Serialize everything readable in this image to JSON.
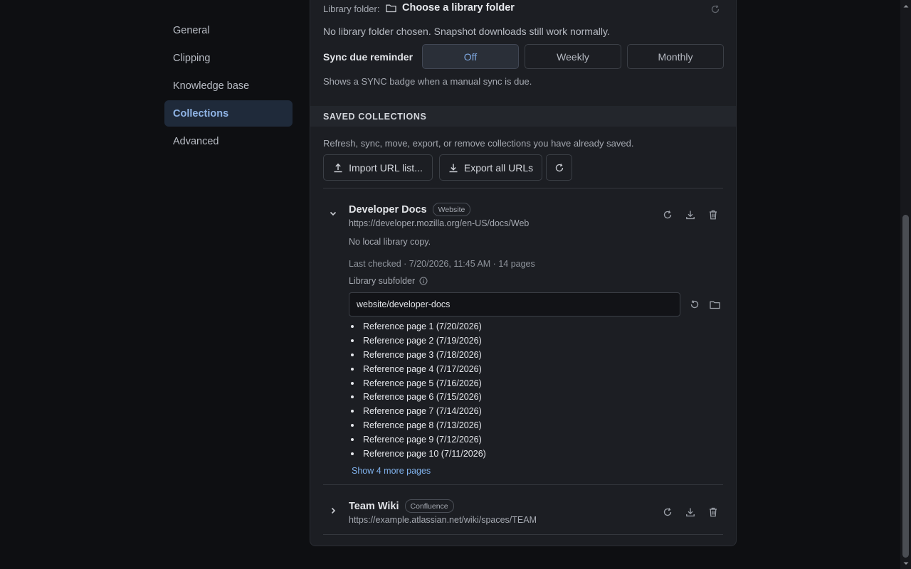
{
  "sidebar": {
    "items": [
      {
        "label": "General"
      },
      {
        "label": "Clipping"
      },
      {
        "label": "Knowledge base"
      },
      {
        "label": "Collections"
      },
      {
        "label": "Advanced"
      }
    ]
  },
  "library": {
    "label": "Library folder:",
    "choose_label": "Choose a library folder",
    "status": "No library folder chosen. Snapshot downloads still work normally."
  },
  "sync": {
    "label": "Sync due reminder",
    "options": [
      "Off",
      "Weekly",
      "Monthly"
    ],
    "selected": "Off",
    "hint": "Shows a SYNC badge when a manual sync is due."
  },
  "saved": {
    "heading": "SAVED COLLECTIONS",
    "description": "Refresh, sync, move, export, or remove collections you have already saved.",
    "import_label": "Import URL list...",
    "export_label": "Export all URLs"
  },
  "collections": [
    {
      "name": "Developer Docs",
      "badge": "Website",
      "url": "https://developer.mozilla.org/en-US/docs/Web",
      "expanded": true,
      "local_status": "No local library copy.",
      "last_checked": "Last checked · 7/20/2026, 11:45 AM · 14 pages",
      "subfolder_label": "Library subfolder",
      "subfolder_value": "website/developer-docs",
      "pages": [
        "Reference page 1 (7/20/2026)",
        "Reference page 2 (7/19/2026)",
        "Reference page 3 (7/18/2026)",
        "Reference page 4 (7/17/2026)",
        "Reference page 5 (7/16/2026)",
        "Reference page 6 (7/15/2026)",
        "Reference page 7 (7/14/2026)",
        "Reference page 8 (7/13/2026)",
        "Reference page 9 (7/12/2026)",
        "Reference page 10 (7/11/2026)"
      ],
      "show_more": "Show 4 more pages"
    },
    {
      "name": "Team Wiki",
      "badge": "Confluence",
      "url": "https://example.atlassian.net/wiki/spaces/TEAM",
      "expanded": false
    }
  ],
  "icons": {
    "folder": "folder-icon",
    "refresh": "refresh-icon",
    "upload": "upload-icon",
    "download": "download-icon",
    "trash": "trash-icon",
    "info": "info-icon",
    "reset": "reset-icon",
    "chevron_down": "chevron-down-icon",
    "chevron_right": "chevron-right-icon"
  },
  "colors": {
    "background": "#0e0f12",
    "panel": "#1c1e23",
    "accent": "#7fa8e0",
    "link": "#7fb0ea",
    "sidebar_active_bg": "#1f2a3a"
  }
}
